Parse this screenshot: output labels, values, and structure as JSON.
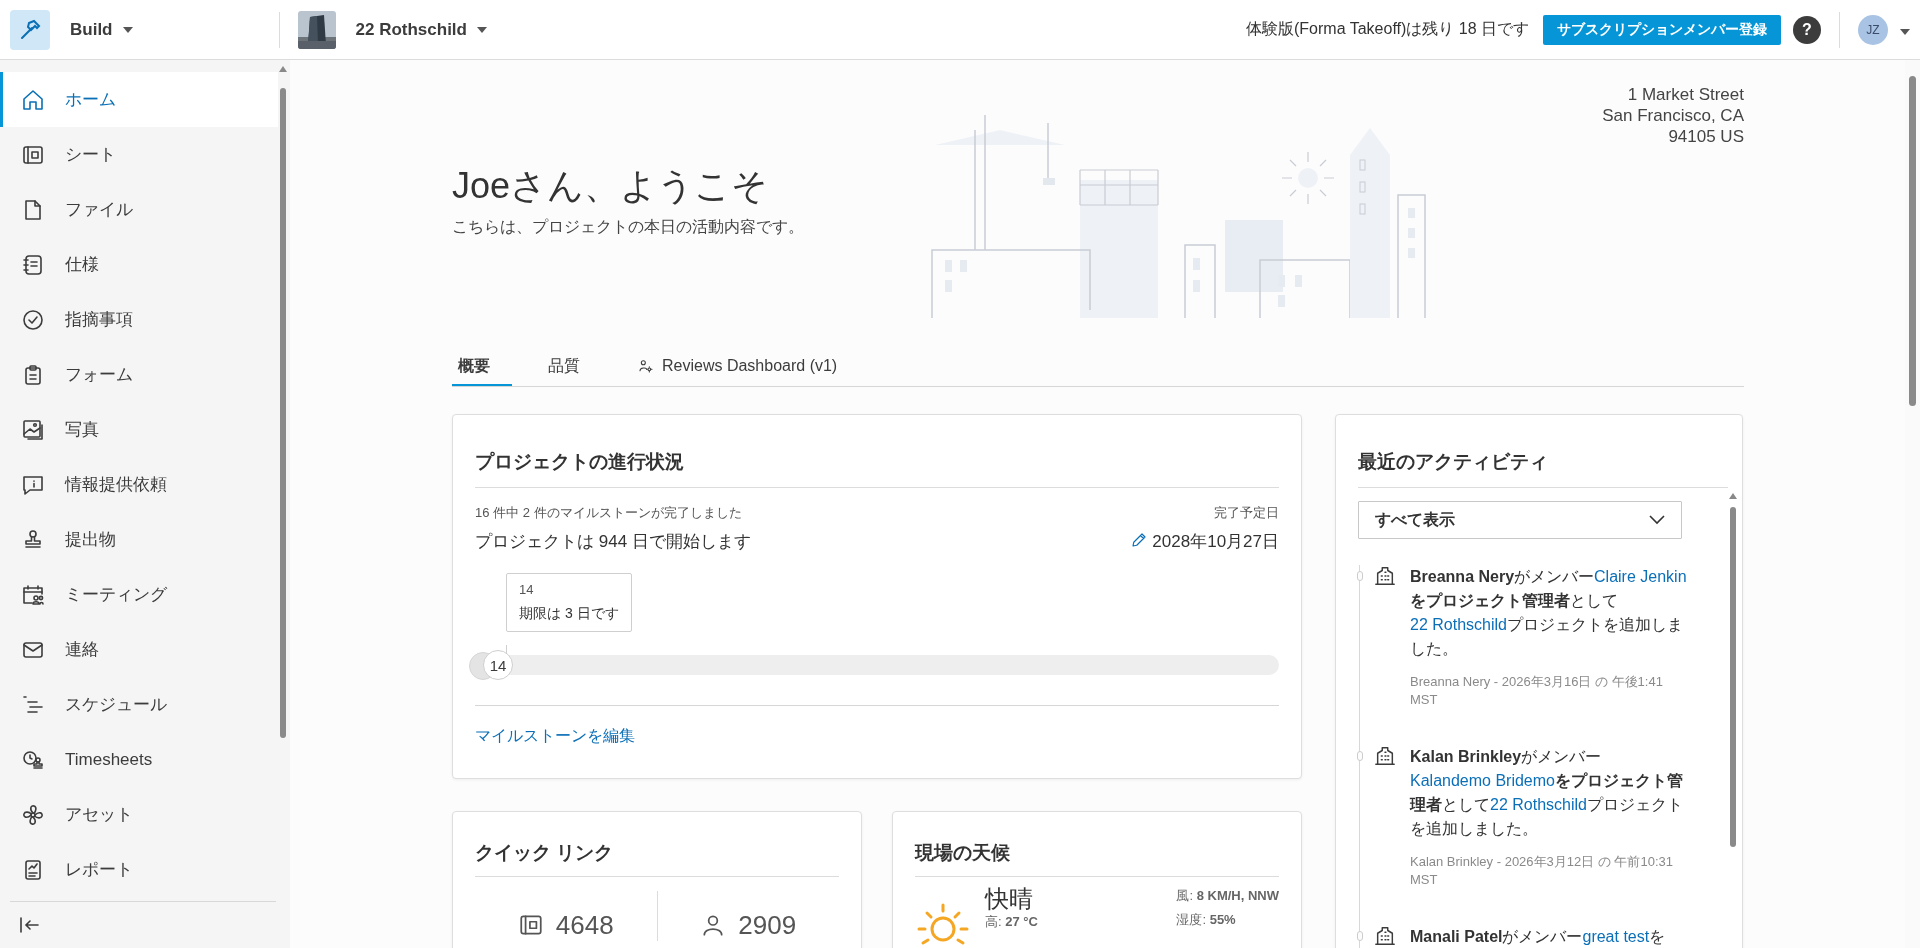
{
  "app": {
    "name": "Build"
  },
  "project": {
    "name": "22 Rothschild"
  },
  "trial": {
    "text": "体験版(Forma Takeoff)は残り 18 日です"
  },
  "subscribe_button": "サブスクリプションメンバー登録",
  "help": "?",
  "user": {
    "initials": "JZ"
  },
  "sidebar": {
    "items": [
      {
        "label": "ホーム",
        "selected": true
      },
      {
        "label": "シート",
        "selected": false
      },
      {
        "label": "ファイル",
        "selected": false
      },
      {
        "label": "仕様",
        "selected": false
      },
      {
        "label": "指摘事項",
        "selected": false
      },
      {
        "label": "フォーム",
        "selected": false
      },
      {
        "label": "写真",
        "selected": false
      },
      {
        "label": "情報提供依頼",
        "selected": false
      },
      {
        "label": "提出物",
        "selected": false
      },
      {
        "label": "ミーティング",
        "selected": false
      },
      {
        "label": "連絡",
        "selected": false
      },
      {
        "label": "スケジュール",
        "selected": false
      },
      {
        "label": "Timesheets",
        "selected": false
      },
      {
        "label": "アセット",
        "selected": false
      },
      {
        "label": "レポート",
        "selected": false
      }
    ]
  },
  "header": {
    "title": "Joeさん、ようこそ",
    "subtitle": "こちらは、プロジェクトの本日の活動内容です。",
    "address": [
      "1 Market Street",
      "San Francisco, CA",
      "94105 US"
    ]
  },
  "tabs": [
    {
      "label": "概要",
      "selected": true,
      "kind": "plain"
    },
    {
      "label": "品質",
      "selected": false,
      "kind": "plain"
    },
    {
      "label": "Reviews Dashboard (v1)",
      "selected": false,
      "kind": "dashboard"
    }
  ],
  "progress": {
    "title": "プロジェクトの進行状況",
    "summary": "16 件中 2 件のマイルストーンが完了しました",
    "start_text": "プロジェクトは 944 日で開始します",
    "due_label": "完了予定日",
    "due_date": "2028年10月27日",
    "milestone": {
      "number": "14",
      "due": "期限は 3 日です"
    },
    "marker": "14",
    "edit_link": "マイルストーンを編集"
  },
  "activity": {
    "title": "最近のアクティビティ",
    "filter": "すべて表示",
    "items": [
      {
        "segments": [
          {
            "kind": "bold",
            "text": "Breanna Nery"
          },
          {
            "kind": "plain",
            "text": "がメンバー"
          },
          {
            "kind": "link",
            "text": "Claire Jenkin"
          },
          {
            "kind": "bold",
            "text": "をプロジェクト管理者"
          },
          {
            "kind": "plain",
            "text": "として"
          },
          {
            "kind": "link",
            "text": "22 Rothschild"
          },
          {
            "kind": "plain",
            "text": "プロジェクトを追加しました。"
          }
        ],
        "meta": "Breanna Nery - 2026年3月16日 の 午後1:41 MST"
      },
      {
        "segments": [
          {
            "kind": "bold",
            "text": "Kalan Brinkley"
          },
          {
            "kind": "plain",
            "text": "がメンバー"
          },
          {
            "kind": "link",
            "text": "Kalandemo Bridemo"
          },
          {
            "kind": "bold",
            "text": "をプロジェクト管理者"
          },
          {
            "kind": "plain",
            "text": "として"
          },
          {
            "kind": "link",
            "text": "22 Rothschild"
          },
          {
            "kind": "plain",
            "text": "プロジェクトを追加しました。"
          }
        ],
        "meta": "Kalan Brinkley - 2026年3月12日 の 午前10:31 MST"
      },
      {
        "segments": [
          {
            "kind": "bold",
            "text": "Manali Patel"
          },
          {
            "kind": "plain",
            "text": "がメンバー"
          },
          {
            "kind": "link",
            "text": "great test"
          },
          {
            "kind": "plain",
            "text": "を"
          }
        ]
      }
    ]
  },
  "quick_links": {
    "title": "クイック リンク",
    "items": [
      {
        "count": "4648",
        "kind": "sheets"
      },
      {
        "count": "2909",
        "kind": "members"
      }
    ]
  },
  "weather": {
    "title": "現場の天候",
    "condition": "快晴",
    "high": "高: **27 °C**",
    "wind": "風: **8 KM/H, NNW**",
    "humidity": "湿度: **55%**"
  }
}
